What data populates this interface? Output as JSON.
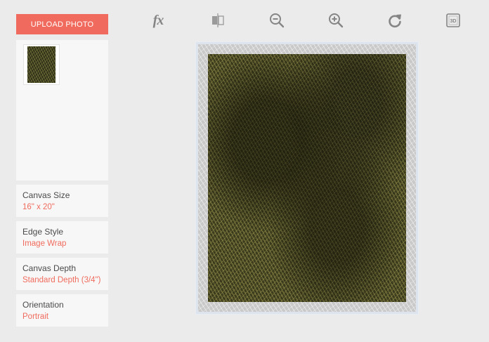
{
  "sidebar": {
    "upload_label": "UPLOAD PHOTO",
    "options": [
      {
        "label": "Canvas Size",
        "value": "16\" x 20\""
      },
      {
        "label": "Edge Style",
        "value": "Image Wrap"
      },
      {
        "label": "Canvas Depth",
        "value": "Standard Depth (3/4\")"
      },
      {
        "label": "Orientation",
        "value": "Portrait"
      }
    ]
  },
  "toolbar": {
    "fx_label": "fx",
    "three_d_label": "3D",
    "tools": [
      "effects-icon",
      "mirror-flip-icon",
      "zoom-out-icon",
      "zoom-in-icon",
      "rotate-icon",
      "3d-view-icon"
    ]
  },
  "colors": {
    "accent": "#f06b5d",
    "background": "#ebebeb",
    "panel": "#f7f7f7",
    "icon": "#858585"
  }
}
